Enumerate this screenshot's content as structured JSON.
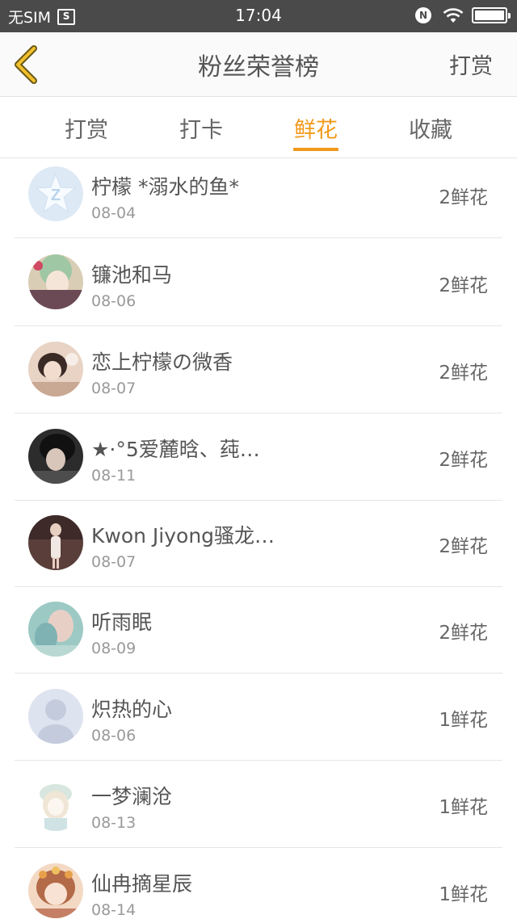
{
  "status_bar": {
    "carrier": "无SIM",
    "sim_icon_text": "S",
    "time": "17:04",
    "nfc_icon_text": "N"
  },
  "header": {
    "back_icon": "chevron-left-icon",
    "title": "粉丝荣誉榜",
    "action": "打赏"
  },
  "tabs": [
    {
      "label": "打赏",
      "active": false
    },
    {
      "label": "打卡",
      "active": false
    },
    {
      "label": "鲜花",
      "active": true
    },
    {
      "label": "收藏",
      "active": false
    }
  ],
  "accent_color": "#f19a1b",
  "list": [
    {
      "name": "柠檬 *溺水的鱼*",
      "date": "08-04",
      "count": "2鲜花",
      "avatar": "default-qq-avatar"
    },
    {
      "name": "镰池和马",
      "date": "08-06",
      "count": "2鲜花",
      "avatar": "anime-avatar-green-hair"
    },
    {
      "name": "恋上柠檬の微香",
      "date": "08-07",
      "count": "2鲜花",
      "avatar": "photo-avatar-girl"
    },
    {
      "name": "★·°5爱麓晗、莼…",
      "date": "08-11",
      "count": "2鲜花",
      "avatar": "photo-avatar-boy"
    },
    {
      "name": "Kwon Jiyong骚龙…",
      "date": "08-07",
      "count": "2鲜花",
      "avatar": "photo-avatar-person-standing"
    },
    {
      "name": "听雨眠",
      "date": "08-09",
      "count": "2鲜花",
      "avatar": "photo-avatar-blurred"
    },
    {
      "name": "炽热的心",
      "date": "08-06",
      "count": "1鲜花",
      "avatar": "default-person-avatar"
    },
    {
      "name": "一梦澜沧",
      "date": "08-13",
      "count": "1鲜花",
      "avatar": "anime-avatar-sketch-girl"
    },
    {
      "name": "仙冉摘星辰",
      "date": "08-14",
      "count": "1鲜花",
      "avatar": "anime-avatar-flower-crown"
    }
  ]
}
